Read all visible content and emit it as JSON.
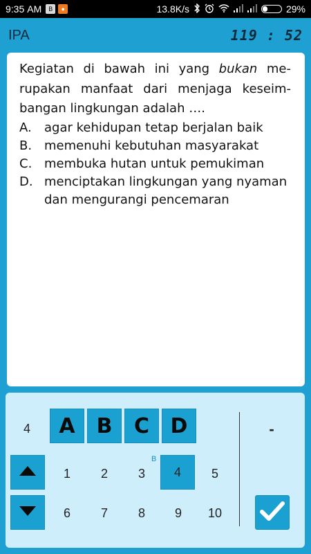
{
  "status_bar": {
    "time": "9:35",
    "ampm": "AM",
    "notif_icons": [
      "bbm-icon",
      "orange-app-icon"
    ],
    "net_speed": "13.8K/s",
    "battery_text": "29%",
    "battery_level": 0.29
  },
  "header": {
    "subject": "IPA",
    "timer": "119 : 52"
  },
  "question": {
    "text_before": "Kegiatan di bawah ini yang ",
    "emphasis": "bukan",
    "text_after": " me-rupakan manfaat dari menjaga keseim-bangan lingkungan adalah ….",
    "options": [
      {
        "letter": "A.",
        "text": "agar kehidupan tetap berjalan baik"
      },
      {
        "letter": "B.",
        "text": "memenuhi kebutuhan masyarakat"
      },
      {
        "letter": "C.",
        "text": "membuka hutan untuk pemukiman"
      },
      {
        "letter": "D.",
        "text": "menciptakan lingkungan yang nyaman dan mengurangi pencemaran"
      }
    ]
  },
  "answer_panel": {
    "current_number": "4",
    "choices": [
      "A",
      "B",
      "C",
      "D"
    ],
    "numbers_row1": [
      "1",
      "2",
      "3",
      "4",
      "5"
    ],
    "numbers_row2": [
      "6",
      "7",
      "8",
      "9",
      "10"
    ],
    "answered_mark": "B",
    "selected_answer": "-",
    "colors": {
      "button_blue": "#1aa1d1",
      "panel_bg": "#cfeefc",
      "app_bg": "#1fa0d3"
    }
  }
}
